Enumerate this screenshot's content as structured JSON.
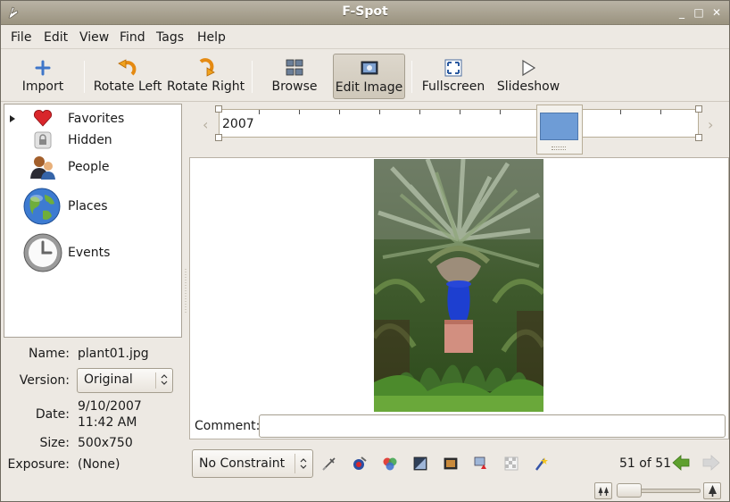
{
  "window": {
    "title": "F-Spot",
    "controls": [
      "minimize",
      "maximize",
      "close"
    ]
  },
  "menubar": {
    "items": [
      "File",
      "Edit",
      "View",
      "Find",
      "Tags",
      "Help"
    ]
  },
  "toolbar": {
    "items": [
      {
        "label": "Import",
        "icon": "import-icon"
      },
      {
        "label": "Rotate Left",
        "icon": "rotate-left-icon"
      },
      {
        "label": "Rotate Right",
        "icon": "rotate-right-icon"
      },
      {
        "label": "Browse",
        "icon": "browse-icon"
      },
      {
        "label": "Edit Image",
        "icon": "edit-image-icon",
        "active": true
      },
      {
        "label": "Fullscreen",
        "icon": "fullscreen-icon"
      },
      {
        "label": "Slideshow",
        "icon": "slideshow-icon"
      }
    ]
  },
  "tags": {
    "items": [
      {
        "label": "Favorites",
        "icon": "heart-icon",
        "expandable": true
      },
      {
        "label": "Hidden",
        "icon": "lock-icon"
      },
      {
        "label": "People",
        "icon": "people-icon"
      },
      {
        "label": "Places",
        "icon": "globe-icon"
      },
      {
        "label": "Events",
        "icon": "clock-icon"
      }
    ]
  },
  "info": {
    "name_label": "Name:",
    "name": "plant01.jpg",
    "version_label": "Version:",
    "version": "Original",
    "date_label": "Date:",
    "date": "9/10/2007",
    "time": "11:42 AM",
    "size_label": "Size:",
    "size": "500x750",
    "exposure_label": "Exposure:",
    "exposure": "(None)"
  },
  "timeline": {
    "year": "2007"
  },
  "viewer": {
    "comment_label": "Comment:",
    "comment_value": ""
  },
  "edit_bar": {
    "constraint": "No Constraint",
    "tools": [
      "crop-icon",
      "red-eye-icon",
      "color-adjust-icon",
      "desaturate-icon",
      "sepia-icon",
      "straighten-icon",
      "soft-focus-icon",
      "auto-color-icon"
    ],
    "count": "51 of 51"
  },
  "colors": {
    "accent_green": "#5ea02e",
    "timeline_thumb": "#6e9cd6",
    "vase_blue": "#1d3fd0"
  }
}
